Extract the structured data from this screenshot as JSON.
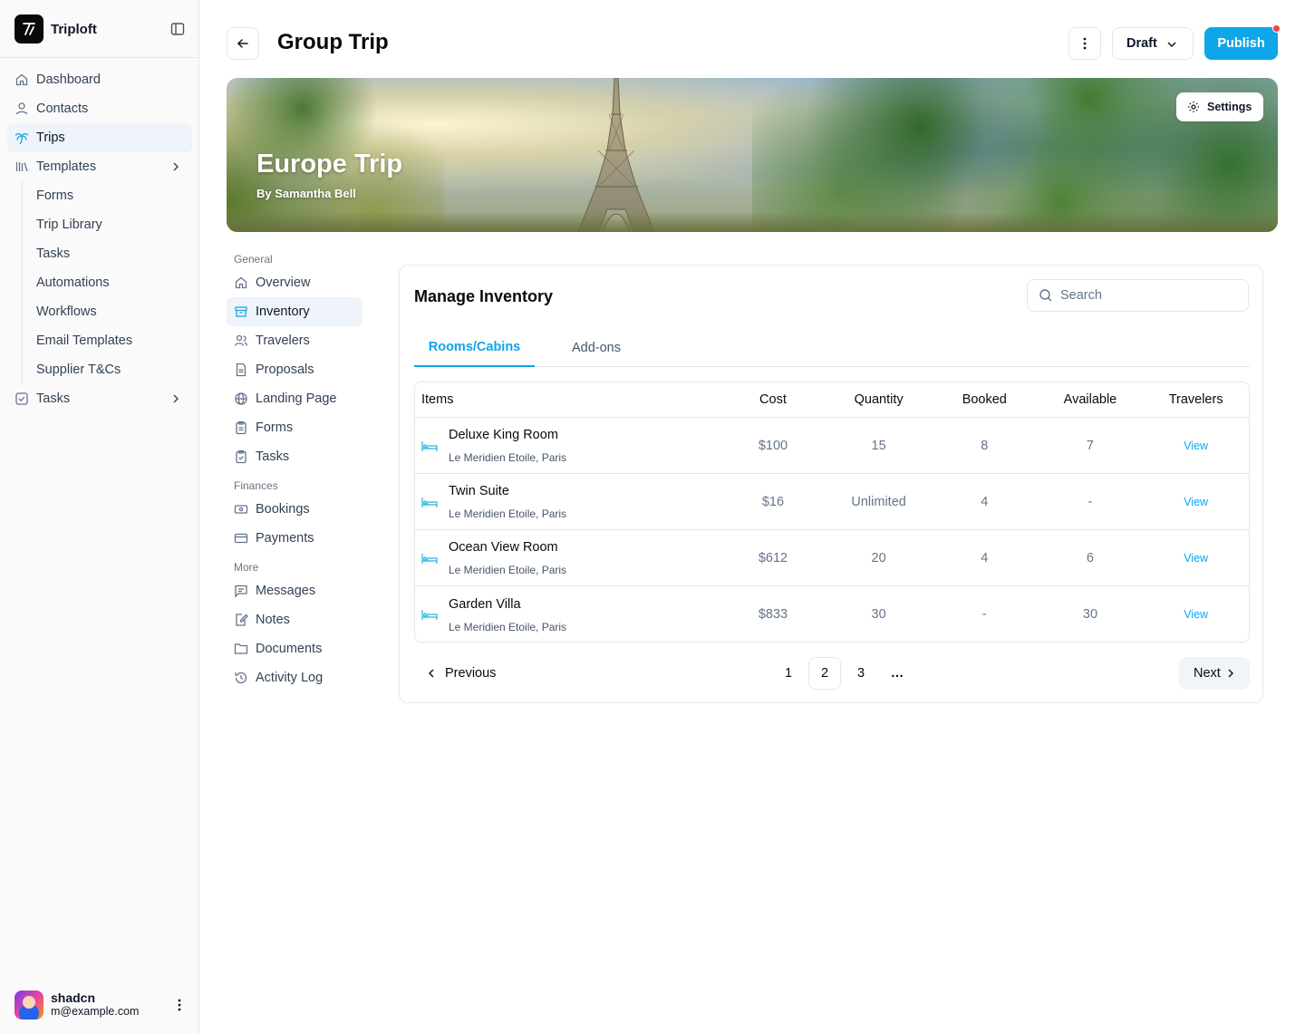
{
  "app": {
    "name": "Triploft"
  },
  "sidebar": {
    "items": [
      {
        "label": "Dashboard",
        "icon": "home-icon"
      },
      {
        "label": "Contacts",
        "icon": "user-icon"
      },
      {
        "label": "Trips",
        "icon": "palm-tree-icon",
        "active": true
      },
      {
        "label": "Templates",
        "icon": "library-icon",
        "expandable": true
      }
    ],
    "template_children": [
      "Forms",
      "Trip Library",
      "Tasks",
      "Automations",
      "Workflows",
      "Email Templates",
      "Supplier T&Cs"
    ],
    "tasks": {
      "label": "Tasks",
      "icon": "checkbox-icon"
    }
  },
  "user": {
    "name": "shadcn",
    "email": "m@example.com"
  },
  "header": {
    "title": "Group Trip",
    "status": "Draft",
    "publish_label": "Publish"
  },
  "banner": {
    "title": "Europe Trip",
    "subtitle": "By Samantha Bell",
    "settings_label": "Settings"
  },
  "trip_nav": {
    "general_label": "General",
    "general": [
      "Overview",
      "Inventory",
      "Travelers",
      "Proposals",
      "Landing Page",
      "Forms",
      "Tasks"
    ],
    "finances_label": "Finances",
    "finances": [
      "Bookings",
      "Payments"
    ],
    "more_label": "More",
    "more": [
      "Messages",
      "Notes",
      "Documents",
      "Activity Log"
    ],
    "active": "Inventory"
  },
  "inventory": {
    "title": "Manage Inventory",
    "search_placeholder": "Search",
    "tabs": [
      "Rooms/Cabins",
      "Add-ons"
    ],
    "columns": [
      "Items",
      "Cost",
      "Quantity",
      "Booked",
      "Available",
      "Travelers"
    ],
    "rows": [
      {
        "name": "Deluxe King Room",
        "location": "Le Meridien Etoile, Paris",
        "cost": "$100",
        "quantity": "15",
        "booked": "8",
        "available": "7",
        "travelers": "View"
      },
      {
        "name": "Twin Suite",
        "location": "Le Meridien Etoile, Paris",
        "cost": "$16",
        "quantity": "Unlimited",
        "booked": "4",
        "available": "-",
        "travelers": "View"
      },
      {
        "name": "Ocean View Room",
        "location": "Le Meridien Etoile, Paris",
        "cost": "$612",
        "quantity": "20",
        "booked": "4",
        "available": "6",
        "travelers": "View"
      },
      {
        "name": "Garden Villa",
        "location": "Le Meridien Etoile, Paris",
        "cost": "$833",
        "quantity": "30",
        "booked": "-",
        "available": "30",
        "travelers": "View"
      }
    ],
    "pagination": {
      "previous": "Previous",
      "next": "Next",
      "pages": [
        "1",
        "2",
        "3"
      ],
      "current": "2",
      "ellipsis": "…"
    }
  },
  "colors": {
    "accent": "#0ea5e9",
    "notification": "#ef4444"
  }
}
